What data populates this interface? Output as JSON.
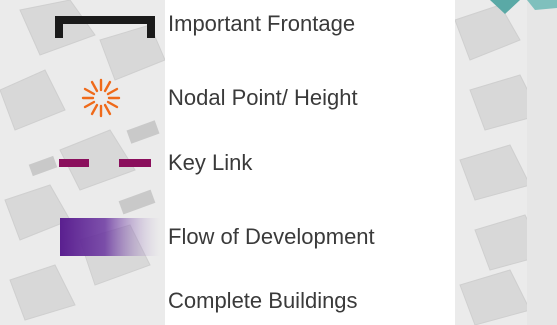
{
  "legend": {
    "items": [
      {
        "id": "important-frontage",
        "label": "Important Frontage",
        "icon": "frontage-bracket-icon",
        "color": "#1a1a1a"
      },
      {
        "id": "nodal-point",
        "label": "Nodal Point/ Height",
        "icon": "sunburst-icon",
        "color": "#ef6a1a"
      },
      {
        "id": "key-link",
        "label": "Key Link",
        "icon": "dashed-line-icon",
        "color": "#8a0f5c"
      },
      {
        "id": "flow-of-development",
        "label": "Flow of Development",
        "icon": "gradient-arrow-icon",
        "color": "#5a1f8f"
      },
      {
        "id": "complete-buildings",
        "label": "Complete Buildings",
        "icon": "none",
        "color": "#ffffff"
      }
    ]
  },
  "colors": {
    "map_background": "#ebebeb",
    "map_buildings": "#d6d6d6",
    "panel": "#ffffff",
    "teal_accent": "#5aa9a6"
  }
}
